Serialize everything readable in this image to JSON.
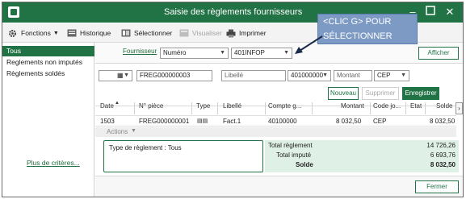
{
  "window": {
    "title": "Saisie des règlements fournisseurs",
    "controls": [
      "minimize-icon",
      "maximize-icon",
      "close-icon"
    ]
  },
  "callout": {
    "line1": "<CLIC G> POUR",
    "line2": "SÉLECTIONNER"
  },
  "toolbar": {
    "functions_label": "Fonctions",
    "history_label": "Historique",
    "select_label": "Sélectionner",
    "view_label": "Visualiser",
    "print_label": "Imprimer"
  },
  "sidebar": {
    "items": [
      {
        "label": "Tous",
        "active": true
      },
      {
        "label": "Reglements non imputés",
        "active": false
      },
      {
        "label": "Règlements soldés",
        "active": false
      }
    ],
    "more_criteria": "Plus de critères..."
  },
  "filter": {
    "supplier_link": "Fournisseur",
    "supplier_mode": "Numéro",
    "supplier_value": "401INFOP",
    "display_button": "Afficher"
  },
  "entry": {
    "date_value": "",
    "piece_number": "FREG000000003",
    "label_placeholder": "Libellé",
    "account_value": "401000000",
    "amount_placeholder": "Montant",
    "journal_code": "CEP",
    "new_button": "Nouveau",
    "delete_button": "Supprimer",
    "save_button": "Enregistrer"
  },
  "grid": {
    "columns": [
      "Date",
      "N° pièce",
      "Type",
      "Libellé",
      "Compte g...",
      "Montant",
      "Code jo...",
      "Etat",
      "Solde"
    ],
    "rows": [
      {
        "date": "1503",
        "piece": "FREG000000001",
        "type": "",
        "label": "Fact.1",
        "account": "40100000",
        "amount": "8 032,50",
        "journal": "CEP",
        "state": "",
        "balance": "8 032,50"
      }
    ],
    "actions_label": "Actions"
  },
  "summary": {
    "type_label": "Type de règlement : Tous",
    "total_settlement_label": "Total règlement",
    "total_settlement_value": "14 726,26",
    "total_imputed_label": "Total imputé",
    "total_imputed_value": "6 693,76",
    "balance_label": "Solde",
    "balance_value": "8 032,50"
  },
  "footer": {
    "close_button": "Fermer"
  },
  "colors": {
    "accent": "#217346",
    "callout": "#7d9ac4",
    "totals_bg": "#dff0e6"
  }
}
